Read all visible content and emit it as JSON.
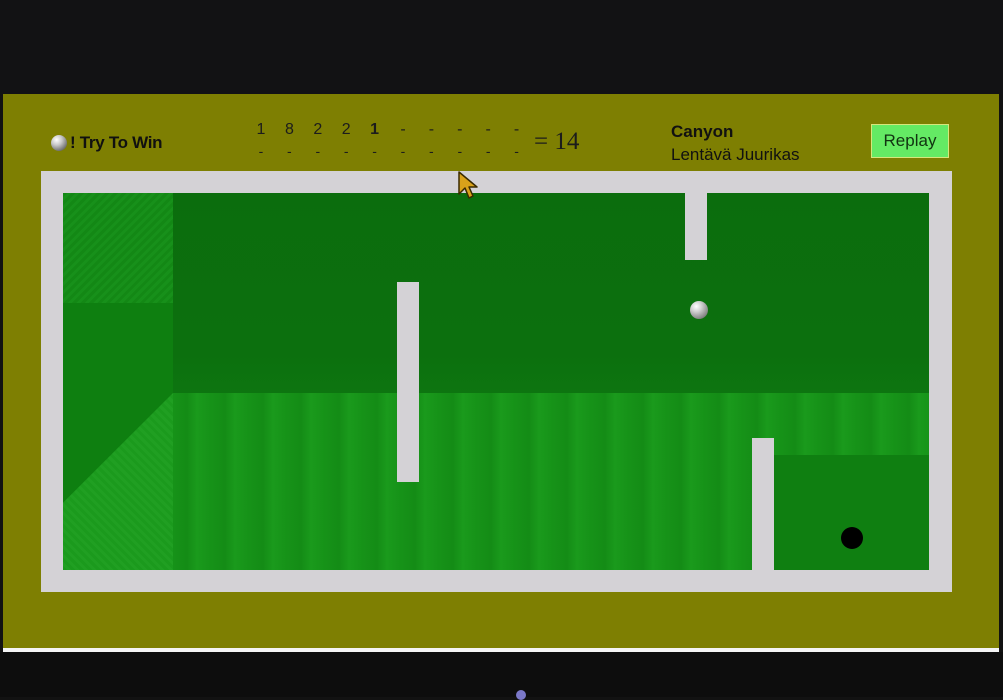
{
  "player": {
    "name": "! Try To Win"
  },
  "scorecard": {
    "scores": [
      "1",
      "8",
      "2",
      "2",
      "1",
      "-",
      "-",
      "-",
      "-",
      "-"
    ],
    "current_hole_index": 4,
    "second_row": [
      "-",
      "-",
      "-",
      "-",
      "-",
      "-",
      "-",
      "-",
      "-",
      "-"
    ],
    "total": "= 14"
  },
  "course": {
    "name": "Canyon",
    "author": "Lentävä Juurikas"
  },
  "buttons": {
    "replay_label": "Replay"
  },
  "icons": {
    "player_ball": "ball-icon",
    "cursor": "arrow-cursor-icon"
  },
  "colors": {
    "background": "#7e7f02",
    "course_frame": "#d4d2d6",
    "green_dark": "#0b6d0d",
    "green_light": "#169218",
    "replay_button": "#64ea64"
  }
}
